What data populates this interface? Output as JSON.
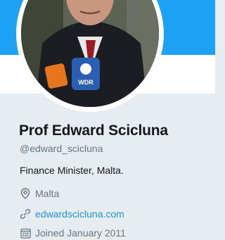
{
  "profile": {
    "name": "Prof Edward Scicluna",
    "handle": "@edward_scicluna",
    "bio": "Finance Minister, Malta.",
    "location": "Malta",
    "website": "edwardscicluna.com",
    "joined": "Joined January 2011"
  },
  "avatar": {
    "microphone_label": "WDR"
  },
  "colors": {
    "banner": "#1da1f2",
    "background": "#e6ecf0",
    "name": "#14171a",
    "secondary_text": "#657786",
    "link": "#1b95e0"
  },
  "icons": {
    "location": "map-pin-icon",
    "website": "link-icon",
    "joined": "calendar-icon"
  }
}
